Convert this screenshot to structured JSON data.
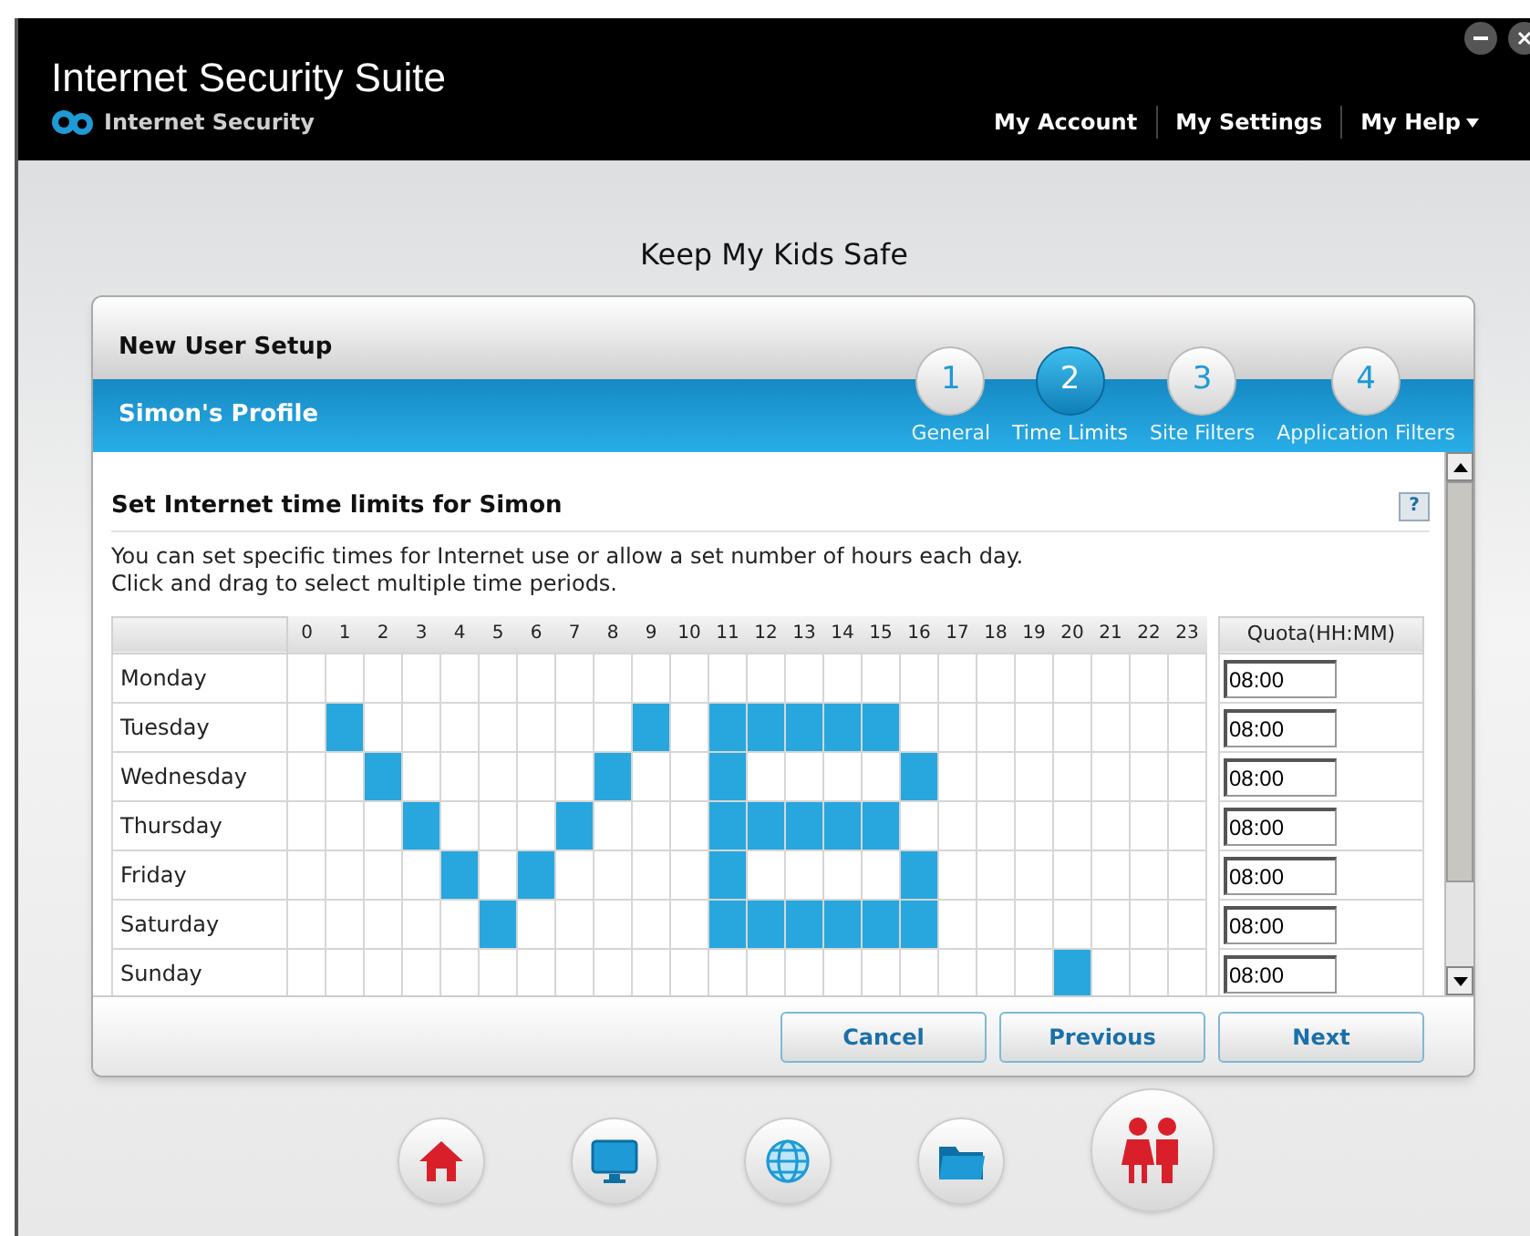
{
  "window": {
    "title": "Internet Security Suite",
    "brand": "Internet Security"
  },
  "top_nav": [
    {
      "label": "My Account",
      "kind": "link"
    },
    {
      "label": "My Settings",
      "kind": "link"
    },
    {
      "label": "My Help",
      "kind": "menu"
    }
  ],
  "page_title": "Keep My Kids Safe",
  "panel": {
    "title": "New User Setup",
    "profile": "Simon's Profile",
    "steps": [
      {
        "number": "1",
        "label": "General",
        "selected": false
      },
      {
        "number": "2",
        "label": "Time Limits",
        "selected": true
      },
      {
        "number": "3",
        "label": "Site Filters",
        "selected": false
      },
      {
        "number": "4",
        "label": "Application Filters",
        "selected": false
      }
    ],
    "section_title": "Set Internet time limits for Simon",
    "help": "?",
    "description": "You can set specific times for Internet use or allow a set number of hours each day.\nClick and drag to select multiple time periods.",
    "hours": [
      "0",
      "1",
      "2",
      "3",
      "4",
      "5",
      "6",
      "7",
      "8",
      "9",
      "10",
      "11",
      "12",
      "13",
      "14",
      "15",
      "16",
      "17",
      "18",
      "19",
      "20",
      "21",
      "22",
      "23"
    ],
    "quota_header": "Quota(HH:MM)",
    "rows": [
      {
        "day": "Monday",
        "quota": "08:00",
        "cells": [
          false,
          false,
          false,
          false,
          false,
          false,
          false,
          false,
          false,
          false,
          false,
          false,
          false,
          false,
          false,
          false,
          false,
          false,
          false,
          false,
          false,
          false,
          false,
          false
        ]
      },
      {
        "day": "Tuesday",
        "quota": "08:00",
        "cells": [
          false,
          true,
          false,
          false,
          false,
          false,
          false,
          false,
          false,
          true,
          false,
          true,
          true,
          true,
          true,
          true,
          false,
          false,
          false,
          false,
          false,
          false,
          false,
          false
        ]
      },
      {
        "day": "Wednesday",
        "quota": "08:00",
        "cells": [
          false,
          false,
          true,
          false,
          false,
          false,
          false,
          false,
          true,
          false,
          false,
          true,
          false,
          false,
          false,
          false,
          true,
          false,
          false,
          false,
          false,
          false,
          false,
          false
        ]
      },
      {
        "day": "Thursday",
        "quota": "08:00",
        "cells": [
          false,
          false,
          false,
          true,
          false,
          false,
          false,
          true,
          false,
          false,
          false,
          true,
          true,
          true,
          true,
          true,
          false,
          false,
          false,
          false,
          false,
          false,
          false,
          false
        ]
      },
      {
        "day": "Friday",
        "quota": "08:00",
        "cells": [
          false,
          false,
          false,
          false,
          true,
          false,
          true,
          false,
          false,
          false,
          false,
          true,
          false,
          false,
          false,
          false,
          true,
          false,
          false,
          false,
          false,
          false,
          false,
          false
        ]
      },
      {
        "day": "Saturday",
        "quota": "08:00",
        "cells": [
          false,
          false,
          false,
          false,
          false,
          true,
          false,
          false,
          false,
          false,
          false,
          true,
          true,
          true,
          true,
          true,
          true,
          false,
          false,
          false,
          false,
          false,
          false,
          false
        ]
      },
      {
        "day": "Sunday",
        "quota": "08:00",
        "cells": [
          false,
          false,
          false,
          false,
          false,
          false,
          false,
          false,
          false,
          false,
          false,
          false,
          false,
          false,
          false,
          false,
          false,
          false,
          false,
          false,
          true,
          false,
          false,
          false
        ]
      }
    ],
    "buttons": [
      "Cancel",
      "Previous",
      "Next"
    ]
  },
  "dock": [
    {
      "kind": "home",
      "selected": false
    },
    {
      "kind": "monitor",
      "selected": false
    },
    {
      "kind": "globe",
      "selected": false
    },
    {
      "kind": "folder",
      "selected": false
    },
    {
      "kind": "kids",
      "selected": true
    }
  ]
}
